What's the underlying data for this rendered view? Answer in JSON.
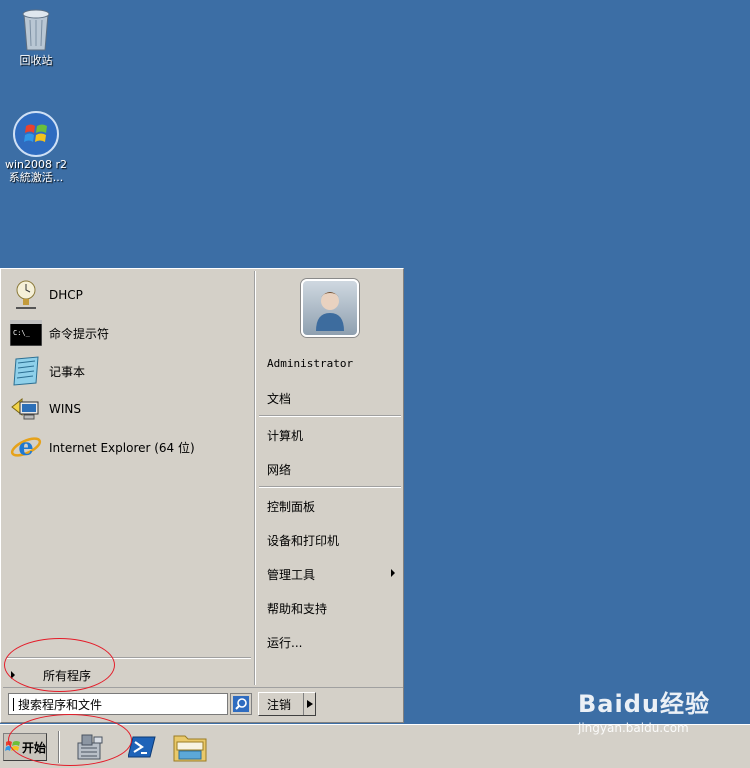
{
  "desktop": {
    "icons": [
      {
        "label": "回收站"
      },
      {
        "label_line1": "win2008 r2",
        "label_line2": "系統激活..."
      }
    ]
  },
  "start_menu": {
    "programs": [
      {
        "label": "DHCP",
        "icon": "dhcp-icon"
      },
      {
        "label": "命令提示符",
        "icon": "cmd-icon"
      },
      {
        "label": "记事本",
        "icon": "notepad-icon"
      },
      {
        "label": "WINS",
        "icon": "wins-icon"
      },
      {
        "label": "Internet Explorer (64 位)",
        "icon": "ie-icon"
      }
    ],
    "all_programs": "所有程序",
    "right_items": {
      "user": "Administrator",
      "documents": "文档",
      "computer": "计算机",
      "network": "网络",
      "control_panel": "控制面板",
      "devices": "设备和打印机",
      "admin_tools": "管理工具",
      "help": "帮助和支持",
      "run": "运行..."
    },
    "search_placeholder": "搜索程序和文件",
    "logoff": "注销"
  },
  "taskbar": {
    "start_label": "开始",
    "quick_launch": [
      "server-manager-icon",
      "powershell-icon",
      "explorer-icon"
    ]
  },
  "watermark": {
    "main": "Baidu经验",
    "sub": "jingyan.baidu.com"
  },
  "colors": {
    "desktop": "#3c6ea5",
    "menu_bg": "#d4d0c8",
    "annotation": "#e41d2a"
  }
}
